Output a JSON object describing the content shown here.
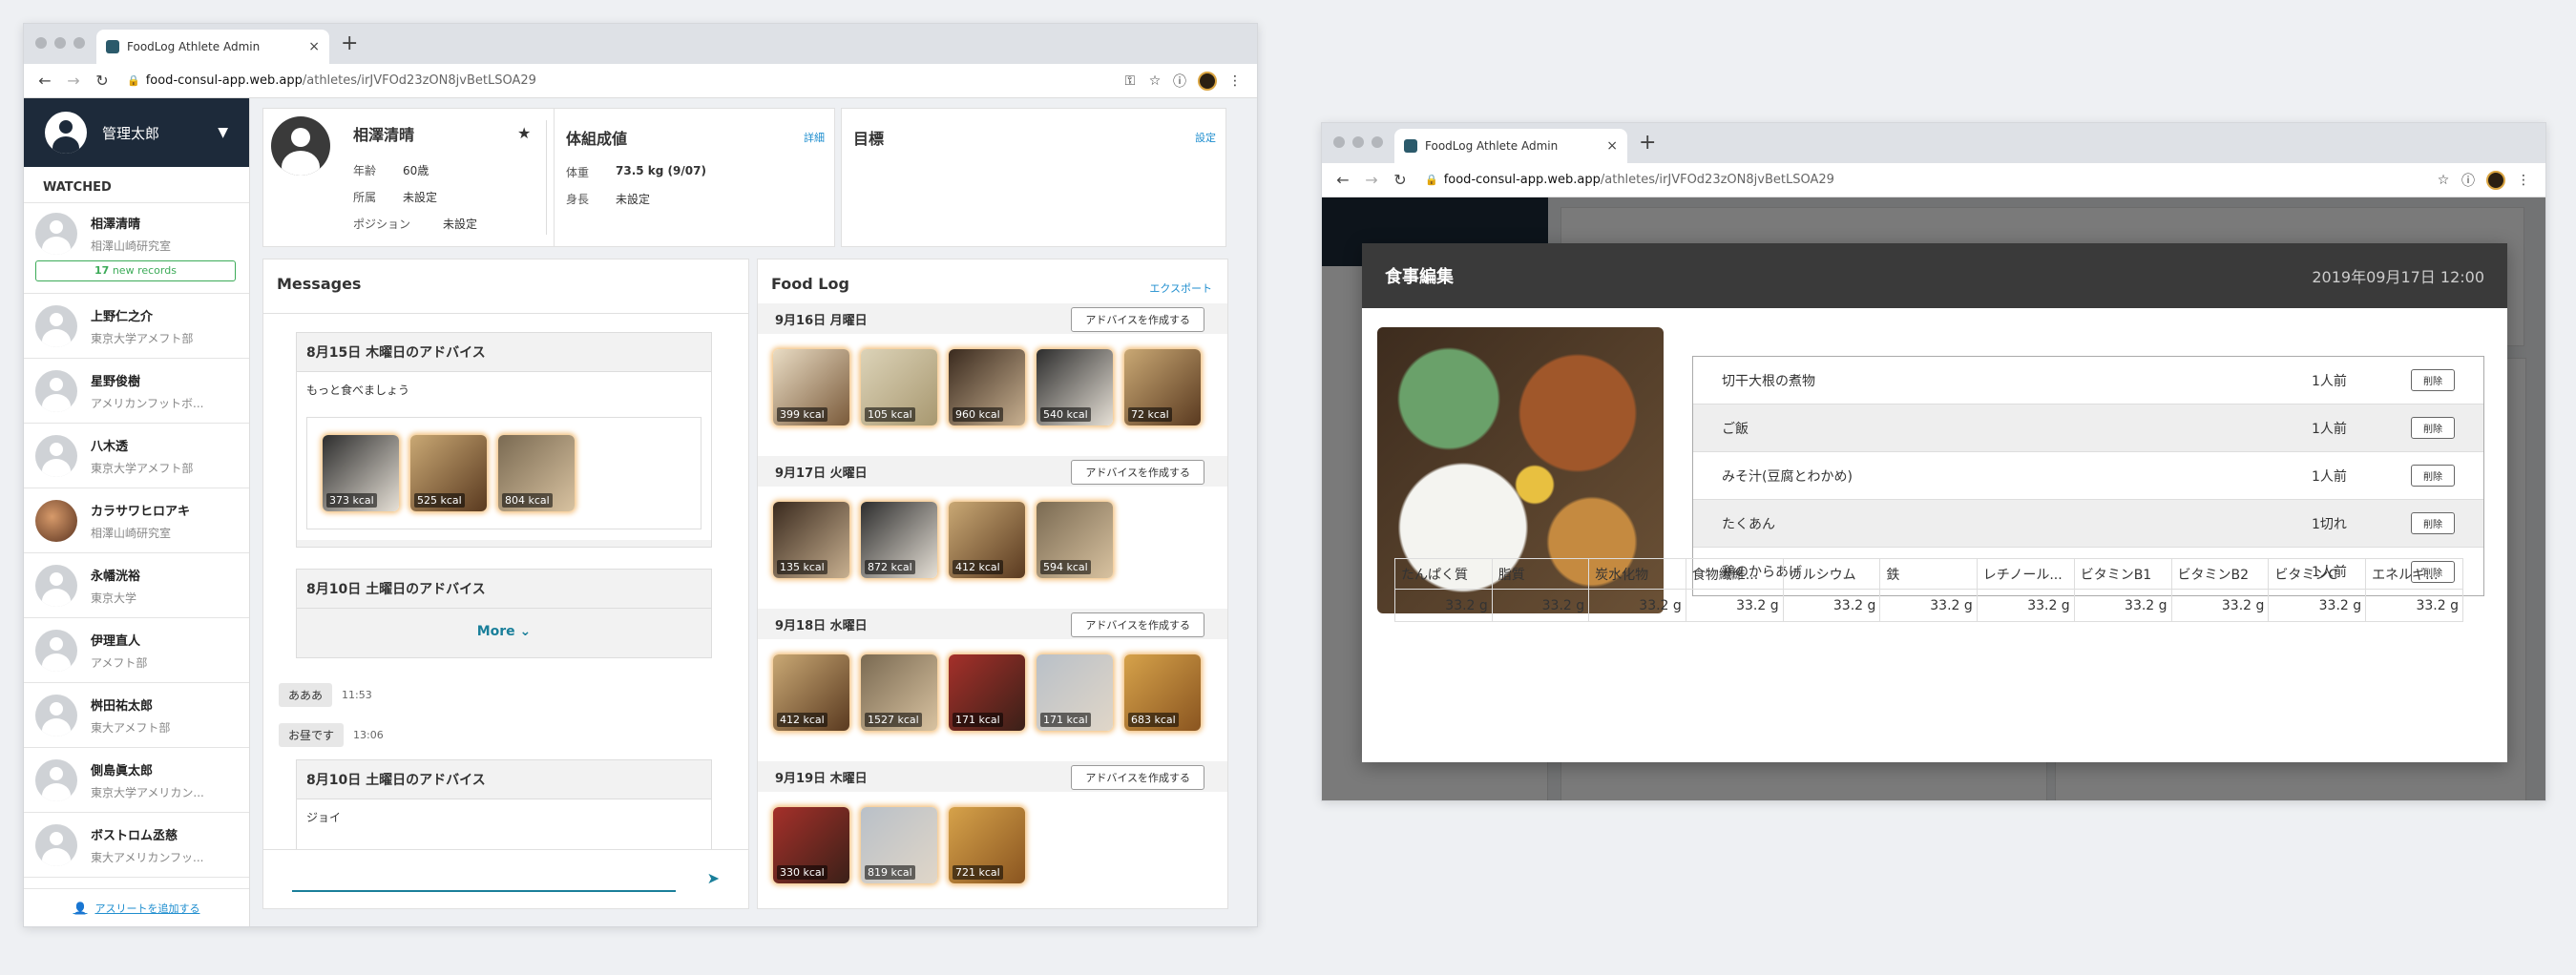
{
  "browser": {
    "tab_title": "FoodLog Athlete Admin",
    "tab_close": "×",
    "new_tab": "+",
    "url_host": "food-consul-app.web.app",
    "url_path": "/athletes/irJVFOd23zON8jvBetLSOA29"
  },
  "sidebar": {
    "user_name": "管理太郎",
    "caret": "▼",
    "watched_label": "WATCHED",
    "athletes": [
      {
        "name": "相澤清晴",
        "org": "相澤山崎研究室",
        "new_count": "17",
        "new_label": " new records"
      },
      {
        "name": "上野仁之介",
        "org": "東京大学アメフト部"
      },
      {
        "name": "星野俊樹",
        "org": "アメリカンフットボ..."
      },
      {
        "name": "八木透",
        "org": "東京大学アメフト部"
      },
      {
        "name": "カラサワヒロアキ",
        "org": "相澤山崎研究室"
      },
      {
        "name": "永幡洸裕",
        "org": "東京大学"
      },
      {
        "name": "伊理直人",
        "org": "アメフト部"
      },
      {
        "name": "桝田祐太郎",
        "org": "東大アメフト部"
      },
      {
        "name": "側島眞太郎",
        "org": "東京大学アメリカン..."
      },
      {
        "name": "ボストロム丞慈",
        "org": "東大アメリカンフッ..."
      }
    ],
    "add_athlete": "アスリートを追加する"
  },
  "profile": {
    "name": "相澤清晴",
    "star": "★",
    "age_label": "年齢",
    "age": "60歳",
    "org_label": "所属",
    "org": "未設定",
    "pos_label": "ポジション",
    "pos": "未設定"
  },
  "body": {
    "title": "体組成値",
    "detail_link": "詳細",
    "weight_label": "体重",
    "weight": "73.5 kg (9/07)",
    "height_label": "身長",
    "height": "未設定"
  },
  "goal": {
    "title": "目標",
    "set_link": "設定"
  },
  "messages": {
    "title": "Messages",
    "advice1": {
      "title": "8月15日 木曜日のアドバイス",
      "text": "もっと食べましょう",
      "kcal": [
        "373 kcal",
        "525 kcal",
        "804 kcal"
      ]
    },
    "advice2": {
      "title": "8月10日 土曜日のアドバイス",
      "more": "More ⌄"
    },
    "chat1": {
      "text": "あああ",
      "time": "11:53"
    },
    "chat2": {
      "text": "お昼です",
      "time": "13:06"
    },
    "advice3": {
      "title": "8月10日 土曜日のアドバイス",
      "text": "ジョイ"
    },
    "send_icon": "➤"
  },
  "foodlog": {
    "title": "Food Log",
    "export": "エクスポート",
    "create_advice": "アドバイスを作成する",
    "days": [
      {
        "label": "9月16日 月曜日",
        "kcal": [
          "399 kcal",
          "105 kcal",
          "960 kcal",
          "540 kcal",
          "72 kcal"
        ]
      },
      {
        "label": "9月17日 火曜日",
        "kcal": [
          "135 kcal",
          "872 kcal",
          "412 kcal",
          "594 kcal"
        ]
      },
      {
        "label": "9月18日 水曜日",
        "kcal": [
          "412 kcal",
          "1527 kcal",
          "171 kcal",
          "171 kcal",
          "683 kcal"
        ]
      },
      {
        "label": "9月19日 木曜日",
        "kcal": [
          "330 kcal",
          "819 kcal",
          "721 kcal"
        ]
      }
    ]
  },
  "modal": {
    "title": "食事編集",
    "datetime": "2019年09月17日 12:00",
    "delete_label": "削除",
    "items": [
      {
        "name": "切干大根の煮物",
        "qty": "1人前"
      },
      {
        "name": "ご飯",
        "qty": "1人前"
      },
      {
        "name": "みそ汁(豆腐とわかめ)",
        "qty": "1人前"
      },
      {
        "name": "たくあん",
        "qty": "1切れ"
      },
      {
        "name": "鶏のからあげ",
        "qty": "1人前"
      }
    ],
    "nutrients": [
      "たんぱく質",
      "脂質",
      "炭水化物",
      "食物繊維...",
      "カルシウム",
      "鉄",
      "レチノール...",
      "ビタミンB1",
      "ビタミンB2",
      "ビタミンC",
      "エネルギ..."
    ],
    "values": [
      "33.2 g",
      "33.2 g",
      "33.2 g",
      "33.2 g",
      "33.2 g",
      "33.2 g",
      "33.2 g",
      "33.2 g",
      "33.2 g",
      "33.2 g",
      "33.2 g"
    ]
  },
  "colors": {
    "sidebar_header": "#1d2a3a",
    "accent_link": "#1f8ecf",
    "new_records_green": "#3cab58",
    "modal_header": "#3a3a3a"
  }
}
